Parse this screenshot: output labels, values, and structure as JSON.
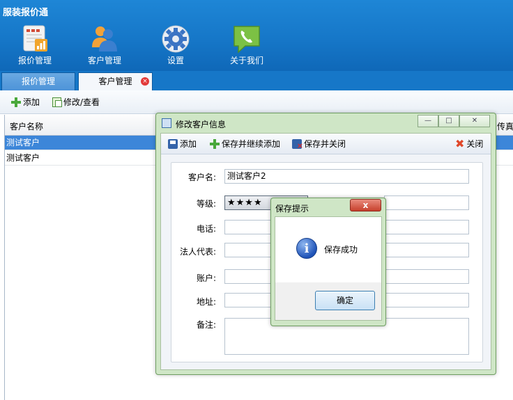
{
  "app": {
    "title": "服装报价通"
  },
  "ribbon": [
    {
      "label": "报价管理",
      "icon": "chart-document-icon"
    },
    {
      "label": "客户管理",
      "icon": "users-icon"
    },
    {
      "label": "设置",
      "icon": "gear-icon"
    },
    {
      "label": "关于我们",
      "icon": "phone-chat-icon"
    }
  ],
  "tabs": [
    {
      "label": "报价管理",
      "active": false
    },
    {
      "label": "客户管理",
      "active": true,
      "close": "×"
    }
  ],
  "toolbar": {
    "add_label": "添加",
    "edit_label": "修改/查看"
  },
  "grid": {
    "headers": [
      "客户名称",
      "传真"
    ],
    "rows": [
      "测试客户",
      "测试客户"
    ]
  },
  "edit_dialog": {
    "title": "修改客户信息",
    "window_buttons": [
      "—",
      "□",
      "✕"
    ],
    "toolbar": {
      "add": "添加",
      "save_continue": "保存并继续添加",
      "save_close": "保存并关闭",
      "close": "关闭"
    },
    "fields": {
      "name_label": "客户名:",
      "name_value": "测试客户2",
      "level_label": "等级:",
      "level_stars": "★★★★",
      "phone_label": "电话:",
      "legal_label": "法人代表:",
      "account_label": "账户:",
      "address_label": "地址:",
      "note_label": "备注:"
    }
  },
  "message_box": {
    "title": "保存提示",
    "close": "x",
    "icon": "info-icon",
    "icon_glyph": "i",
    "message": "保存成功",
    "ok_label": "确定"
  },
  "colors": {
    "header_blue": "#1677c8",
    "selected_row": "#3c86d9",
    "dialog_frame": "#cfe6c6",
    "close_red": "#c7402c"
  }
}
